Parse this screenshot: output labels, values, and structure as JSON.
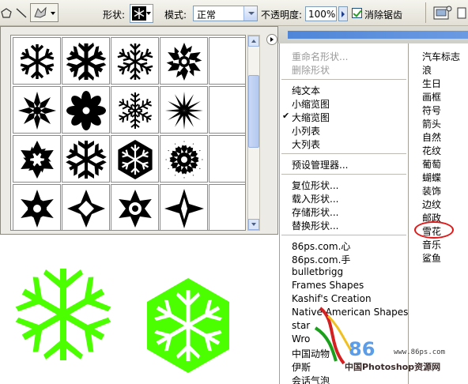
{
  "toolbar": {
    "shape_label": "形状:",
    "mode_label": "模式:",
    "mode_value": "正常",
    "opacity_label": "不透明度:",
    "opacity_value": "100%",
    "antialias_label": "消除锯齿",
    "antialias_checked": true
  },
  "shape_grid": {
    "rows": 4,
    "cols": 5,
    "icon_fill": "#000000"
  },
  "menu": {
    "group1": [
      {
        "label": "重命名形状...",
        "enabled": false
      },
      {
        "label": "删除形状",
        "enabled": false
      }
    ],
    "group2": [
      {
        "label": "纯文本",
        "checked": false
      },
      {
        "label": "小缩览图",
        "checked": false
      },
      {
        "label": "大缩览图",
        "checked": true
      },
      {
        "label": "小列表",
        "checked": false
      },
      {
        "label": "大列表",
        "checked": false
      }
    ],
    "group3": [
      {
        "label": "预设管理器..."
      }
    ],
    "group4": [
      {
        "label": "复位形状..."
      },
      {
        "label": "载入形状..."
      },
      {
        "label": "存储形状..."
      },
      {
        "label": "替换形状..."
      }
    ],
    "group5": [
      {
        "label": "86ps.com.心"
      },
      {
        "label": "86ps.com.手"
      },
      {
        "label": "bulletbrigg"
      },
      {
        "label": "Frames Shapes"
      },
      {
        "label": "Kashif's Creation"
      },
      {
        "label": "Native American Shapes"
      },
      {
        "label": "star"
      },
      {
        "label": "Wro"
      },
      {
        "label": "中国动物"
      },
      {
        "label": "伊斯"
      },
      {
        "label": "会话气泡"
      }
    ]
  },
  "submenu": {
    "items": [
      {
        "label": "汽车标志"
      },
      {
        "label": "浪"
      },
      {
        "label": "生日"
      },
      {
        "label": "画框"
      },
      {
        "label": "符号"
      },
      {
        "label": "箭头"
      },
      {
        "label": "自然"
      },
      {
        "label": "花纹"
      },
      {
        "label": "葡萄"
      },
      {
        "label": "蝴蝶"
      },
      {
        "label": "装饰"
      },
      {
        "label": "边纹"
      },
      {
        "label": "邮政"
      },
      {
        "label": "雪花"
      },
      {
        "label": "音乐"
      },
      {
        "label": "鲨鱼"
      }
    ],
    "highlighted": "雪花",
    "highlight_color": "#e01818"
  },
  "canvas": {
    "shape_color": "#4cff00"
  },
  "watermark": {
    "number": "86",
    "site": "www.86ps.com",
    "name": "中国Photoshop资源网"
  }
}
